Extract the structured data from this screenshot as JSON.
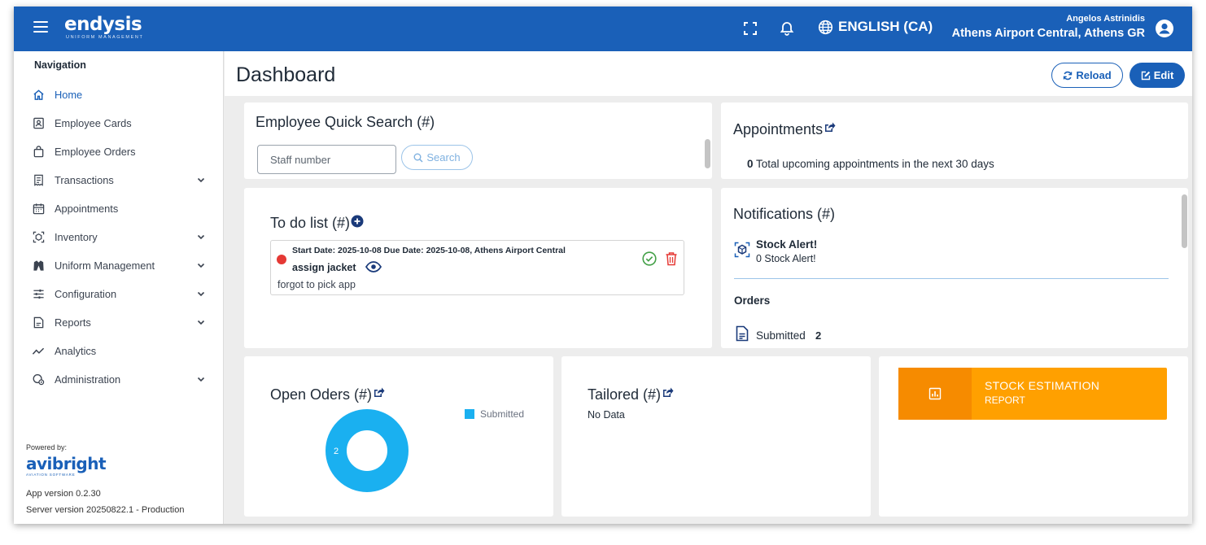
{
  "topbar": {
    "logo_text": "endysis",
    "logo_sub": "UNIFORM MANAGEMENT",
    "language": "ENGLISH (CA)",
    "user_name": "Angelos Astrinidis",
    "user_location": "Athens Airport Central, Athens GR"
  },
  "sidebar": {
    "title": "Navigation",
    "items": [
      {
        "label": "Home",
        "icon": "home-icon",
        "expandable": false,
        "active": true
      },
      {
        "label": "Employee Cards",
        "icon": "id-card-icon",
        "expandable": false
      },
      {
        "label": "Employee Orders",
        "icon": "shopping-bag-icon",
        "expandable": false
      },
      {
        "label": "Transactions",
        "icon": "receipt-icon",
        "expandable": true
      },
      {
        "label": "Appointments",
        "icon": "calendar-icon",
        "expandable": false
      },
      {
        "label": "Inventory",
        "icon": "inventory-icon",
        "expandable": true
      },
      {
        "label": "Uniform Management",
        "icon": "jacket-icon",
        "expandable": true
      },
      {
        "label": "Configuration",
        "icon": "sliders-icon",
        "expandable": true
      },
      {
        "label": "Reports",
        "icon": "report-icon",
        "expandable": true
      },
      {
        "label": "Analytics",
        "icon": "trend-icon",
        "expandable": false
      },
      {
        "label": "Administration",
        "icon": "admin-icon",
        "expandable": true
      }
    ],
    "powered_by": "Powered by:",
    "brand_text": "avibright",
    "brand_sub": "AVIATION SOFTWARE",
    "app_version": "App version 0.2.30",
    "server_version": "Server version 20250822.1 - Production"
  },
  "page": {
    "title": "Dashboard",
    "reload_label": "Reload",
    "edit_label": "Edit"
  },
  "quick_search": {
    "title": "Employee Quick Search (#)",
    "placeholder": "Staff number",
    "button_label": "Search"
  },
  "appointments": {
    "title": "Appointments",
    "count": "0",
    "text": "Total upcoming appointments in the next 30 days"
  },
  "todo": {
    "title": "To do list (#)",
    "items": [
      {
        "dates": "Start Date: 2025-10-08 Due Date: 2025-10-08, Athens Airport Central",
        "name": "assign jacket",
        "description": "forgot to pick app",
        "status_color": "#e53935"
      }
    ]
  },
  "notifications": {
    "title": "Notifications (#)",
    "alert_title": "Stock Alert!",
    "alert_sub": "0 Stock Alert!",
    "orders_heading": "Orders",
    "submitted_label": "Submitted",
    "submitted_count": "2"
  },
  "open_orders": {
    "title": "Open Oders (#)"
  },
  "chart_data": {
    "type": "pie",
    "title": "Open Oders (#)",
    "categories": [
      "Submitted"
    ],
    "values": [
      2
    ],
    "data_labels": [
      "2"
    ],
    "colors": [
      "#1ab0f0"
    ],
    "donut": true,
    "legend": "top-right"
  },
  "tailored": {
    "title": "Tailored (#)",
    "empty_text": "No Data"
  },
  "stock_estimation": {
    "title": "STOCK ESTIMATION",
    "subtitle": "REPORT"
  },
  "colors": {
    "brand_blue": "#1a60b8",
    "orange": "#ffa000",
    "orange_dark": "#f68b00",
    "chart_blue": "#1ab0f0",
    "danger": "#e53935",
    "success": "#43a047"
  }
}
